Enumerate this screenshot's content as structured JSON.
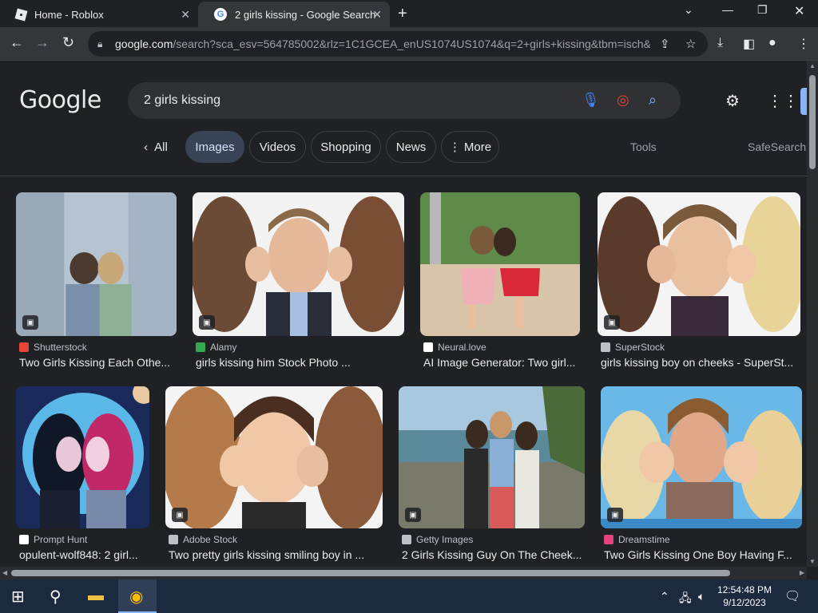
{
  "tabs": [
    {
      "title": "Home - Roblox"
    },
    {
      "title": "2 girls kissing - Google Search"
    }
  ],
  "omnibox": {
    "host": "google.com",
    "path": "/search?sca_esv=564785002&rlz=1C1GCEA_enUS1074US1074&q=2+girls+kissing&tbm=isch&..."
  },
  "google": {
    "logo": "Google",
    "query": "2 girls kissing"
  },
  "filters": {
    "all": "All",
    "images": "Images",
    "videos": "Videos",
    "shopping": "Shopping",
    "news": "News",
    "more": "More",
    "tools": "Tools",
    "safesearch": "SafeSearch"
  },
  "results": [
    {
      "source": "Shutterstock",
      "title": "Two Girls Kissing Each Othe...",
      "color": "#e8443a"
    },
    {
      "source": "Alamy",
      "title": "girls kissing him Stock Photo ...",
      "color": "#34a853"
    },
    {
      "source": "Neural.love",
      "title": "AI Image Generator: Two girl...",
      "color": "#ffffff"
    },
    {
      "source": "SuperStock",
      "title": "girls kissing boy on cheeks - SuperSt...",
      "color": "#bdc1c6"
    },
    {
      "source": "Prompt Hunt",
      "title": "opulent-wolf848: 2 girl...",
      "color": "#ffffff"
    },
    {
      "source": "Adobe Stock",
      "title": "Two pretty girls kissing smiling boy in ...",
      "color": "#bdc1c6"
    },
    {
      "source": "Getty Images",
      "title": "2 Girls Kissing Guy On The Cheek...",
      "color": "#bdc1c6"
    },
    {
      "source": "Dreamstime",
      "title": "Two Girls Kissing One Boy Having F...",
      "color": "#e8437c"
    }
  ],
  "taskbar": {
    "time": "12:54:48 PM",
    "date": "9/12/2023"
  }
}
